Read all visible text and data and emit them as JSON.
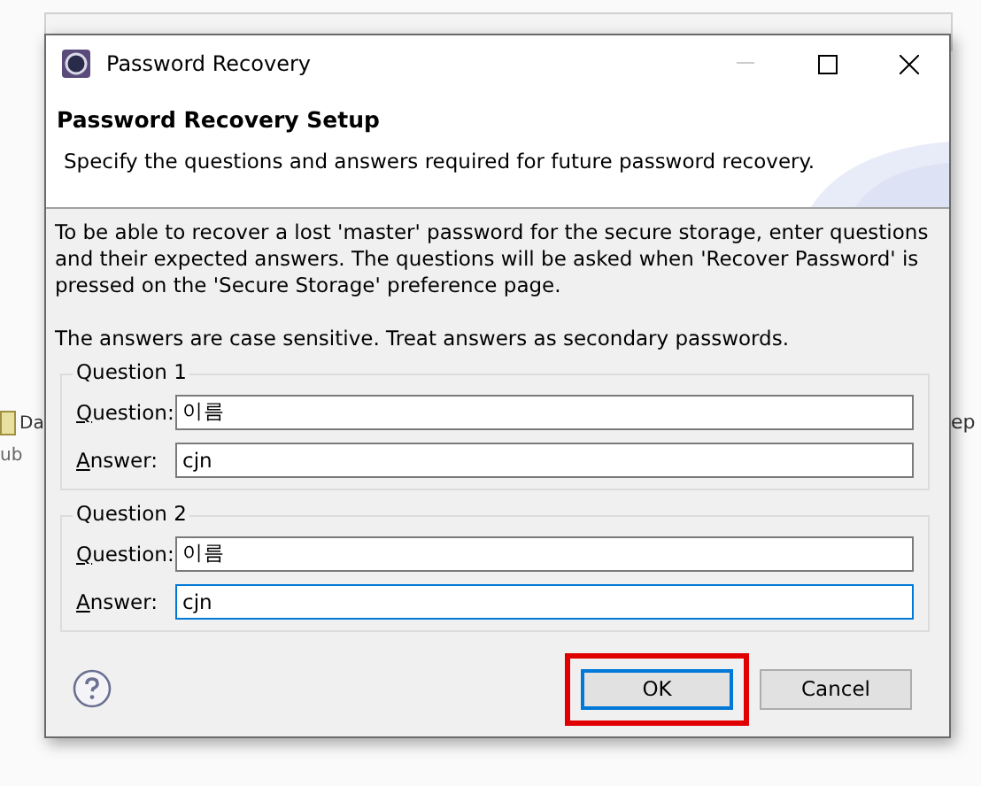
{
  "background": {
    "texts": [
      {
        "kind": "left",
        "text": "Da"
      },
      {
        "kind": "left",
        "text": "ub"
      },
      {
        "kind": "right",
        "text": "ep"
      }
    ]
  },
  "window": {
    "title": "Password Recovery"
  },
  "header": {
    "title": "Password Recovery Setup",
    "description": "Specify the questions and answers required for future password recovery."
  },
  "body": {
    "paragraphs": [
      "To be able to recover a lost 'master' password for the secure storage, enter questions and their expected answers. The questions will be asked when 'Recover Password' is pressed on the 'Secure Storage' preference page.",
      "The answers are case sensitive. Treat answers as secondary passwords."
    ]
  },
  "groups": [
    {
      "title": "Question 1",
      "fields": [
        {
          "label": "Question:",
          "value": "이름",
          "focused": false
        },
        {
          "label": "Answer:",
          "value": "cjn",
          "focused": false
        }
      ]
    },
    {
      "title": "Question 2",
      "fields": [
        {
          "label": "Question:",
          "value": "이름",
          "focused": false
        },
        {
          "label": "Answer:",
          "value": "cjn",
          "focused": true
        }
      ]
    }
  ],
  "buttons": [
    {
      "label": "OK",
      "default": true,
      "highlighted": true
    },
    {
      "label": "Cancel",
      "default": false,
      "highlighted": false
    }
  ]
}
